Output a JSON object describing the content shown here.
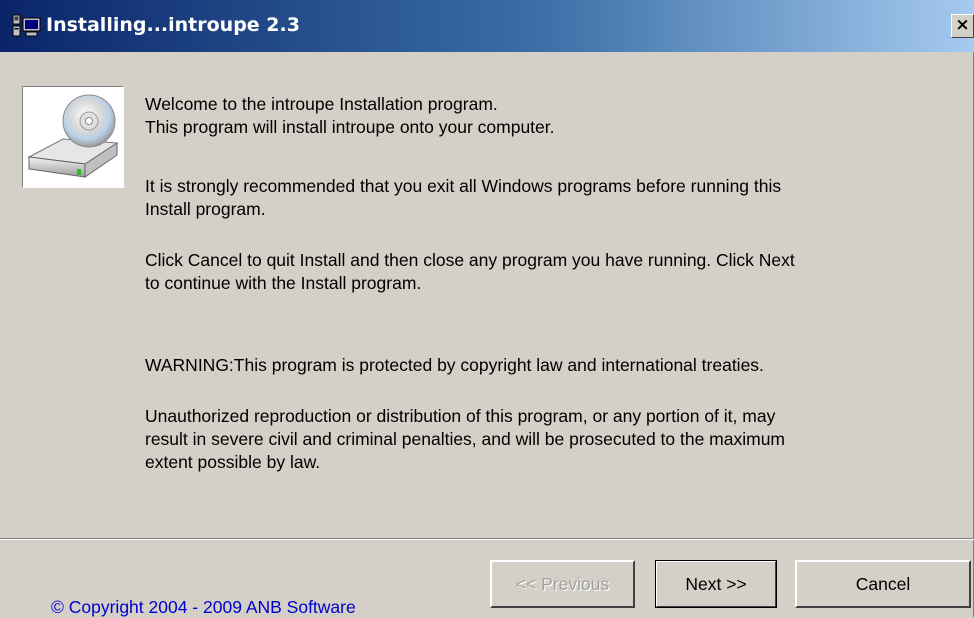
{
  "window": {
    "title": "Installing...introupe 2.3",
    "close_label": "×"
  },
  "messages": {
    "welcome_line1": "Welcome to the introupe Installation program.",
    "welcome_line2": "This program will install introupe onto your computer.",
    "recommend_line1": "It is strongly recommended that you exit all Windows programs before running this",
    "recommend_line2": "Install program.",
    "cancel_line1": "Click Cancel to quit Install and then close any program you have running.  Click Next",
    "cancel_line2": "to continue with the Install program.",
    "warning": "WARNING:This program is protected by copyright law and international treaties.",
    "unauth_line1": "Unauthorized reproduction or distribution of this program, or any portion of it, may",
    "unauth_line2": "result in severe civil and criminal penalties, and will be prosecuted to the maximum",
    "unauth_line3": "extent possible by law."
  },
  "footer": {
    "copyright": "© Copyright 2004 - 2009 ANB Software",
    "previous_label": "<< Previous",
    "next_label": "Next >>",
    "cancel_label": "Cancel"
  },
  "icons": {
    "title": "installer-computer-icon",
    "setup": "cd-drive-icon"
  },
  "colors": {
    "title_bar_start": "#0a246a",
    "title_bar_end": "#a6caf0",
    "dialog_bg": "#d4d0c8",
    "copyright_link": "#0000cc"
  }
}
